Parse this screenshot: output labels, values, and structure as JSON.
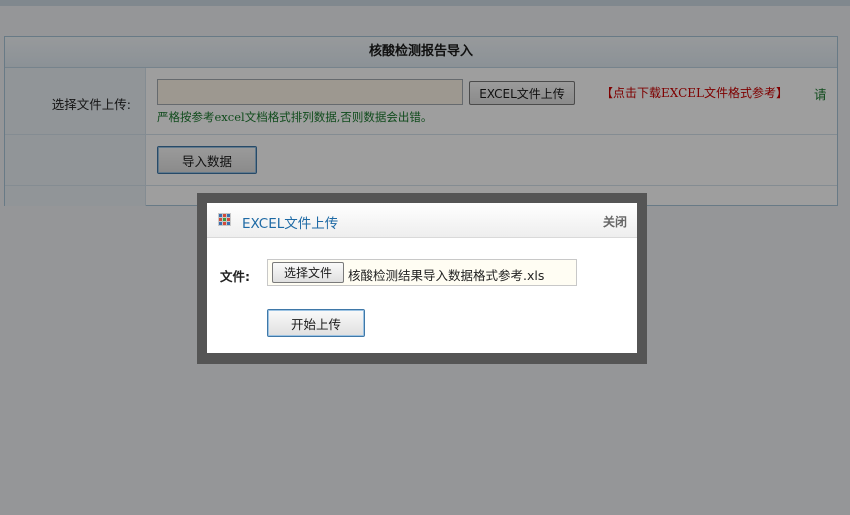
{
  "form": {
    "title": "核酸检测报告导入",
    "upload_label": "选择文件上传:",
    "excel_button": "EXCEL文件上传",
    "download_link": "【点击下载EXCEL文件格式参考】",
    "hint_part1": "请",
    "hint_part2": "严格按参考excel文档格式排列数据,否则数据会出错。",
    "import_button": "导入数据"
  },
  "dialog": {
    "title": "EXCEL文件上传",
    "close": "关闭",
    "file_label": "文件:",
    "choose_button": "选择文件",
    "file_name": "核酸检测结果导入数据格式参考.xls",
    "start_button": "开始上传"
  },
  "colors": {
    "link_red": "#cc0000",
    "hint_green": "#1a7a2e",
    "dialog_title_blue": "#1e6aa5"
  },
  "icons": {
    "dialog_icon": "grid-icon"
  }
}
